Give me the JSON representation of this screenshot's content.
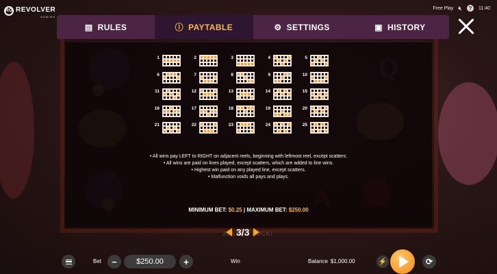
{
  "brand": {
    "name": "REVOLVER",
    "sub": "GAMING",
    "mark": "RG"
  },
  "status": {
    "mode": "Free Play",
    "mute_icon": "speaker-muted-icon",
    "clock": "11:40",
    "help_symbol": "?"
  },
  "tabs": [
    {
      "label": "RULES",
      "icon": "document-icon",
      "glyph": "▤"
    },
    {
      "label": "PAYTABLE",
      "icon": "info-icon",
      "glyph": "ⓘ"
    },
    {
      "label": "SETTINGS",
      "icon": "gear-icon",
      "glyph": "⚙"
    },
    {
      "label": "HISTORY",
      "icon": "history-icon",
      "glyph": "▣"
    }
  ],
  "active_tab": "PAYTABLE",
  "paylines": [
    {
      "num": "1",
      "pattern": [
        [
          0,
          0,
          0,
          0,
          0
        ],
        [
          1,
          1,
          1,
          1,
          1
        ],
        [
          0,
          0,
          0,
          0,
          0
        ]
      ]
    },
    {
      "num": "2",
      "pattern": [
        [
          1,
          1,
          1,
          1,
          1
        ],
        [
          0,
          0,
          0,
          0,
          0
        ],
        [
          0,
          0,
          0,
          0,
          0
        ]
      ]
    },
    {
      "num": "3",
      "pattern": [
        [
          0,
          0,
          0,
          0,
          0
        ],
        [
          0,
          0,
          0,
          0,
          0
        ],
        [
          1,
          1,
          1,
          1,
          1
        ]
      ]
    },
    {
      "num": "4",
      "pattern": [
        [
          1,
          0,
          0,
          0,
          1
        ],
        [
          0,
          1,
          0,
          1,
          0
        ],
        [
          0,
          0,
          1,
          0,
          0
        ]
      ]
    },
    {
      "num": "5",
      "pattern": [
        [
          0,
          0,
          1,
          0,
          0
        ],
        [
          0,
          1,
          0,
          1,
          0
        ],
        [
          1,
          0,
          0,
          0,
          1
        ]
      ]
    },
    {
      "num": "6",
      "pattern": [
        [
          0,
          1,
          1,
          1,
          0
        ],
        [
          1,
          0,
          0,
          0,
          1
        ],
        [
          0,
          0,
          0,
          0,
          0
        ]
      ]
    },
    {
      "num": "7",
      "pattern": [
        [
          0,
          0,
          0,
          0,
          0
        ],
        [
          1,
          0,
          0,
          0,
          1
        ],
        [
          0,
          1,
          1,
          1,
          0
        ]
      ]
    },
    {
      "num": "8",
      "pattern": [
        [
          1,
          1,
          0,
          0,
          0
        ],
        [
          0,
          0,
          1,
          0,
          0
        ],
        [
          0,
          0,
          0,
          1,
          1
        ]
      ]
    },
    {
      "num": "9",
      "pattern": [
        [
          0,
          0,
          0,
          1,
          1
        ],
        [
          0,
          0,
          1,
          0,
          0
        ],
        [
          1,
          1,
          0,
          0,
          0
        ]
      ]
    },
    {
      "num": "10",
      "pattern": [
        [
          0,
          0,
          0,
          0,
          0
        ],
        [
          1,
          0,
          0,
          0,
          1
        ],
        [
          0,
          1,
          1,
          1,
          0
        ]
      ]
    },
    {
      "num": "11",
      "pattern": [
        [
          0,
          1,
          0,
          0,
          0
        ],
        [
          1,
          0,
          1,
          0,
          1
        ],
        [
          0,
          0,
          0,
          1,
          0
        ]
      ]
    },
    {
      "num": "12",
      "pattern": [
        [
          1,
          0,
          0,
          0,
          1
        ],
        [
          0,
          1,
          1,
          1,
          0
        ],
        [
          0,
          0,
          0,
          0,
          0
        ]
      ]
    },
    {
      "num": "13",
      "pattern": [
        [
          0,
          0,
          0,
          0,
          0
        ],
        [
          0,
          1,
          1,
          1,
          0
        ],
        [
          1,
          0,
          0,
          0,
          1
        ]
      ]
    },
    {
      "num": "14",
      "pattern": [
        [
          0,
          1,
          0,
          1,
          0
        ],
        [
          1,
          0,
          1,
          0,
          1
        ],
        [
          0,
          0,
          0,
          0,
          0
        ]
      ]
    },
    {
      "num": "15",
      "pattern": [
        [
          0,
          0,
          0,
          0,
          0
        ],
        [
          1,
          0,
          1,
          0,
          1
        ],
        [
          0,
          1,
          0,
          1,
          0
        ]
      ]
    },
    {
      "num": "16",
      "pattern": [
        [
          0,
          0,
          1,
          0,
          0
        ],
        [
          1,
          1,
          0,
          1,
          1
        ],
        [
          0,
          0,
          0,
          0,
          0
        ]
      ]
    },
    {
      "num": "17",
      "pattern": [
        [
          0,
          0,
          0,
          0,
          0
        ],
        [
          1,
          1,
          0,
          1,
          1
        ],
        [
          0,
          0,
          1,
          0,
          0
        ]
      ]
    },
    {
      "num": "18",
      "pattern": [
        [
          1,
          1,
          0,
          1,
          1
        ],
        [
          0,
          0,
          1,
          0,
          0
        ],
        [
          0,
          0,
          0,
          0,
          0
        ]
      ]
    },
    {
      "num": "19",
      "pattern": [
        [
          0,
          0,
          0,
          0,
          0
        ],
        [
          0,
          0,
          1,
          0,
          0
        ],
        [
          1,
          1,
          0,
          1,
          1
        ]
      ]
    },
    {
      "num": "20",
      "pattern": [
        [
          1,
          0,
          1,
          0,
          1
        ],
        [
          0,
          1,
          0,
          1,
          0
        ],
        [
          0,
          0,
          0,
          0,
          0
        ]
      ]
    },
    {
      "num": "21",
      "pattern": [
        [
          0,
          0,
          0,
          0,
          0
        ],
        [
          0,
          1,
          0,
          1,
          0
        ],
        [
          1,
          0,
          1,
          0,
          1
        ]
      ]
    },
    {
      "num": "22",
      "pattern": [
        [
          1,
          0,
          0,
          0,
          1
        ],
        [
          0,
          0,
          0,
          0,
          0
        ],
        [
          0,
          1,
          1,
          1,
          0
        ]
      ]
    },
    {
      "num": "23",
      "pattern": [
        [
          0,
          1,
          1,
          1,
          0
        ],
        [
          0,
          0,
          0,
          0,
          0
        ],
        [
          1,
          0,
          0,
          0,
          1
        ]
      ]
    },
    {
      "num": "24",
      "pattern": [
        [
          1,
          0,
          1,
          0,
          1
        ],
        [
          0,
          0,
          0,
          0,
          0
        ],
        [
          0,
          1,
          0,
          1,
          0
        ]
      ]
    },
    {
      "num": "25",
      "pattern": [
        [
          0,
          1,
          0,
          1,
          0
        ],
        [
          0,
          0,
          0,
          0,
          0
        ],
        [
          1,
          0,
          1,
          0,
          1
        ]
      ]
    }
  ],
  "rules": [
    "• All wins pay LEFT to RIGHT on adjacent reels, beginning with leftmost reel, except scatters.",
    "• All wins are paid on lines played, except scatters, which are added to line wins.",
    "• Highest win paid on any played line, except scatters.",
    "• Malfunction voids all pays and plays."
  ],
  "bet_range": {
    "min_label": "MINIMUM BET:",
    "min_value": "$0.25",
    "sep": "|",
    "max_label": "MAXIMUM BET:",
    "max_value": "$250.00"
  },
  "pager": {
    "indicator": "3/3"
  },
  "slogan": "25 LIN                 D LUCK!",
  "bottom": {
    "bet_label": "Bet",
    "bet_value": "$250.00",
    "minus": "−",
    "plus": "+",
    "win_label": "Win",
    "balance_label": "Balance",
    "balance_value": "$1,000.00",
    "turbo_glyph": "⚡",
    "auto_glyph": "⟳"
  },
  "colors": {
    "accent": "#f6b94a",
    "orange": "#f39a2c",
    "tab_bg": "#4c2444",
    "tab_active": "#2e1630"
  }
}
